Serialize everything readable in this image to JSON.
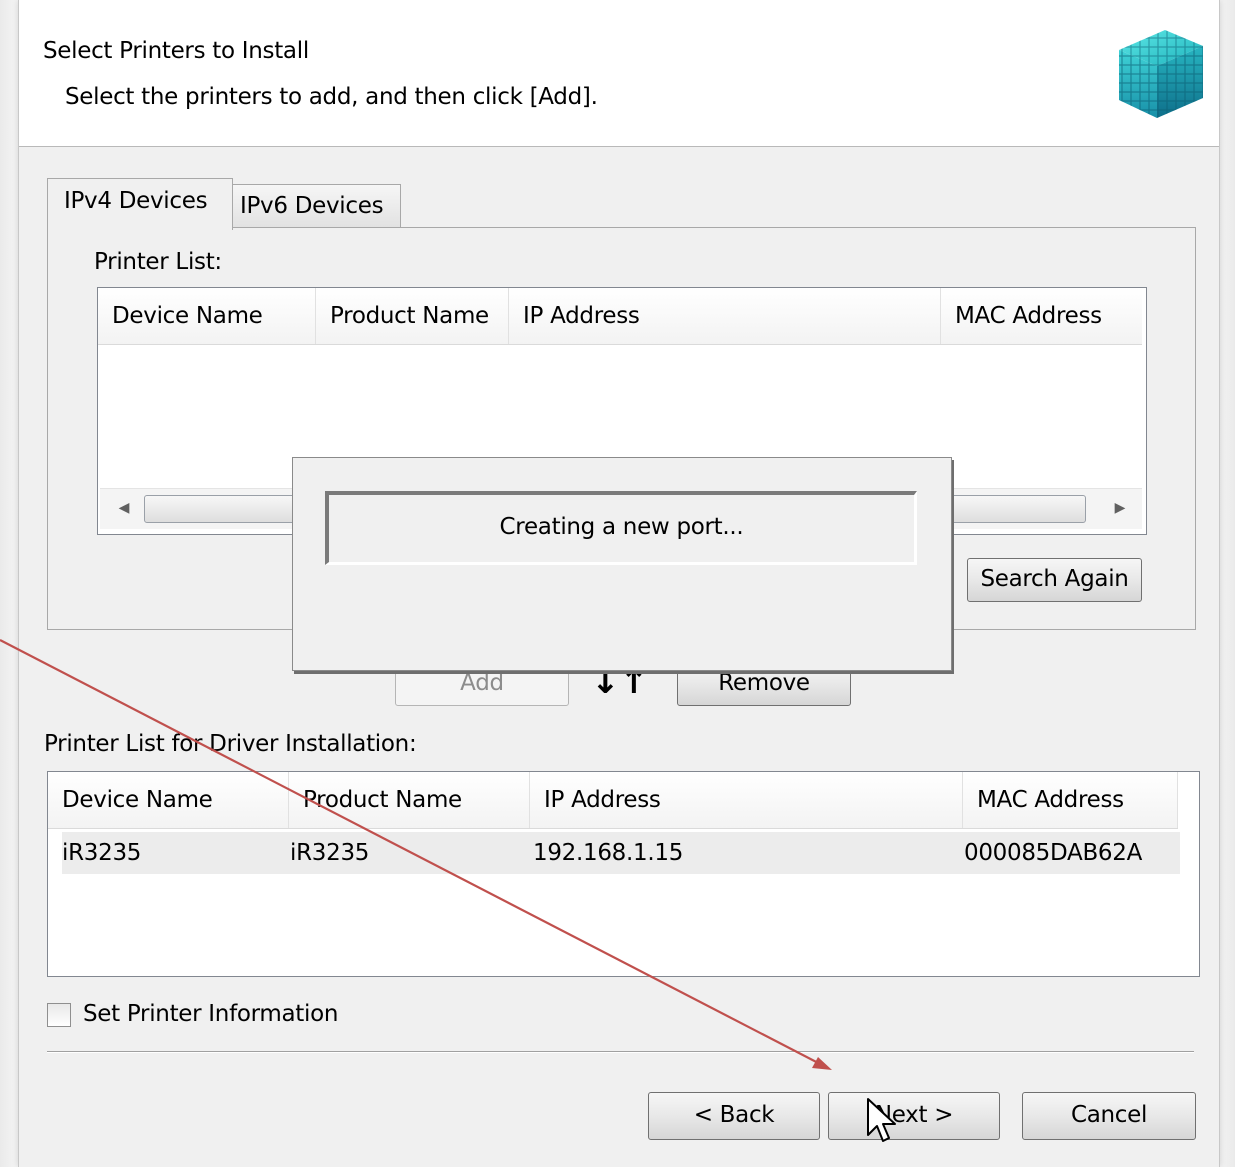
{
  "header": {
    "title": "Select Printers to Install",
    "subtitle": "Select the printers to add, and then click [Add].",
    "logo_icon": "printer-cube-logo-icon"
  },
  "tabs": [
    {
      "label": "IPv4 Devices",
      "selected": true
    },
    {
      "label": "IPv6 Devices",
      "selected": false
    }
  ],
  "printer_list": {
    "label": "Printer List:",
    "columns": [
      "Device Name",
      "Product Name",
      "IP Address",
      "MAC Address"
    ],
    "rows": []
  },
  "search_again_label": "Search Again",
  "add_label": "Add",
  "swap_glyph": "↓↑",
  "remove_label": "Remove",
  "install_list": {
    "label": "Printer List for Driver Installation:",
    "columns": [
      "Device Name",
      "Product Name",
      "IP Address",
      "MAC Address"
    ],
    "rows": [
      {
        "device_name": "iR3235",
        "product_name": "iR3235",
        "ip_address": "192.168.1.15",
        "mac_address": "000085DAB62A"
      }
    ]
  },
  "set_printer_info_label": "Set Printer Information",
  "set_printer_info_checked": false,
  "buttons": {
    "back": "< Back",
    "next": "Next >",
    "cancel": "Cancel"
  },
  "progress_dialog": {
    "message": "Creating a new port..."
  },
  "colors": {
    "annotation_arrow": "#c0504d",
    "logo_teal": "#2ec4c8"
  }
}
